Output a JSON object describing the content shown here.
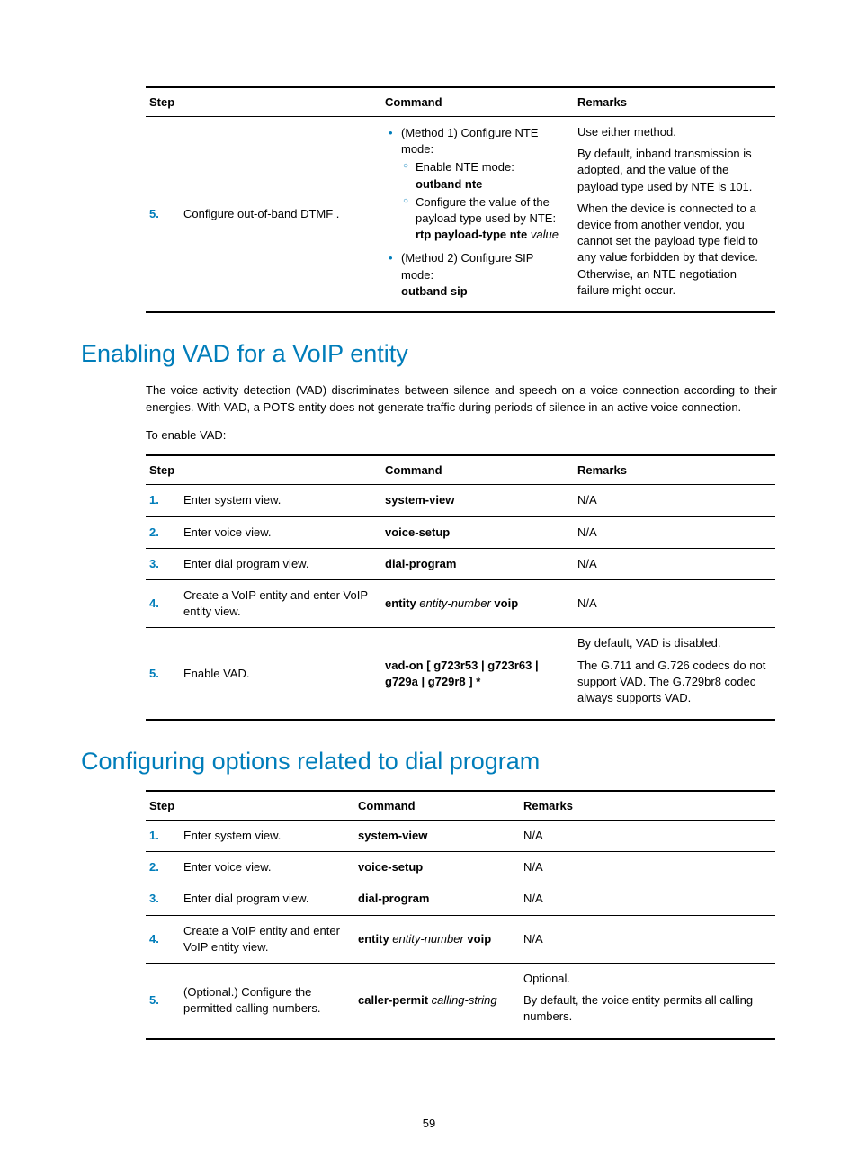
{
  "table1": {
    "headers": [
      "Step",
      "Command",
      "Remarks"
    ],
    "row": {
      "num": "5.",
      "desc": "Configure out-of-band DTMF .",
      "cmd": {
        "m1": "(Method 1) Configure NTE mode:",
        "m1a": "Enable NTE mode:",
        "m1a_cmd": "outband nte",
        "m1b": "Configure the value of the payload type used by NTE:",
        "m1b_cmd_pre": "rtp payload-type nte",
        "m1b_cmd_arg": "value",
        "m2": "(Method 2) Configure SIP mode:",
        "m2_cmd": "outband sip"
      },
      "remarks": {
        "p1": "Use either method.",
        "p2": "By default, inband transmission is adopted, and the value of the payload type used by NTE is 101.",
        "p3": "When the device is connected to a device from another vendor, you cannot set the payload type field to any value forbidden by that device. Otherwise, an NTE negotiation failure might occur."
      }
    }
  },
  "section1": {
    "heading": "Enabling VAD for a VoIP entity",
    "p1": "The voice activity detection (VAD) discriminates between silence and speech on a voice connection according to their energies. With VAD, a POTS entity does not generate traffic during periods of silence in an active voice connection.",
    "p2": "To enable VAD:"
  },
  "table2": {
    "headers": [
      "Step",
      "Command",
      "Remarks"
    ],
    "rows": [
      {
        "num": "1.",
        "desc": "Enter system view.",
        "cmd": "system-view",
        "rem": "N/A"
      },
      {
        "num": "2.",
        "desc": "Enter voice view.",
        "cmd": "voice-setup",
        "rem": "N/A"
      },
      {
        "num": "3.",
        "desc": "Enter dial program view.",
        "cmd": "dial-program",
        "rem": "N/A"
      },
      {
        "num": "4.",
        "desc": "Create a VoIP entity and enter VoIP entity view.",
        "cmd_pre": "entity",
        "cmd_arg": "entity-number",
        "cmd_post": "voip",
        "rem": "N/A"
      },
      {
        "num": "5.",
        "desc": "Enable VAD.",
        "cmd_pre": "vad-on",
        "cmd_args": "[ g723r53 | g723r63 | g729a | g729r8 ] *",
        "rem1": "By default, VAD is disabled.",
        "rem2": "The G.711 and G.726 codecs do not support VAD. The G.729br8 codec always supports VAD."
      }
    ]
  },
  "section2": {
    "heading": "Configuring options related to dial program"
  },
  "table3": {
    "headers": [
      "Step",
      "Command",
      "Remarks"
    ],
    "rows": [
      {
        "num": "1.",
        "desc": "Enter system view.",
        "cmd": "system-view",
        "rem": "N/A"
      },
      {
        "num": "2.",
        "desc": "Enter voice view.",
        "cmd": "voice-setup",
        "rem": "N/A"
      },
      {
        "num": "3.",
        "desc": "Enter dial program view.",
        "cmd": "dial-program",
        "rem": "N/A"
      },
      {
        "num": "4.",
        "desc": "Create a VoIP entity and enter VoIP entity view.",
        "cmd_pre": "entity",
        "cmd_arg": "entity-number",
        "cmd_post": "voip",
        "rem": "N/A"
      },
      {
        "num": "5.",
        "desc": "(Optional.) Configure the permitted calling numbers.",
        "cmd_pre": "caller-permit",
        "cmd_arg": "calling-string",
        "rem1": "Optional.",
        "rem2": "By default, the voice entity permits all calling numbers."
      }
    ]
  },
  "pageNumber": "59"
}
